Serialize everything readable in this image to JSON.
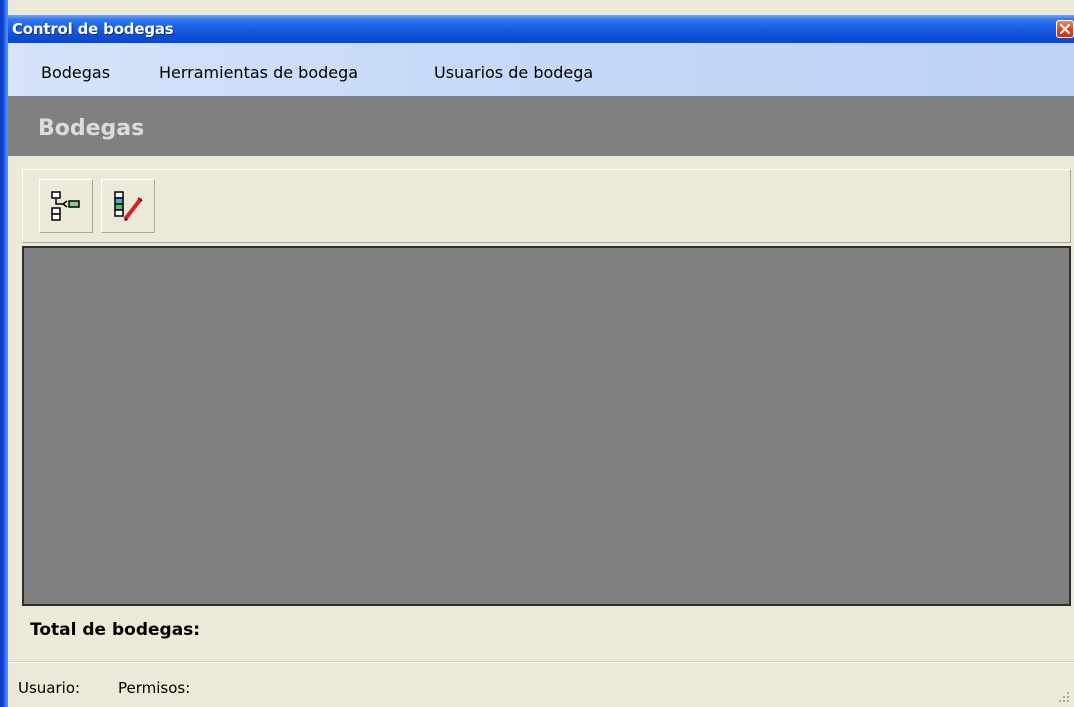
{
  "window": {
    "title": "Control de bodegas",
    "colors": {
      "titlebar": "#0f4fd8",
      "close": "#d8421c",
      "menubar": "#c7d9f8",
      "header": "#808080",
      "content": "#808080",
      "chrome": "#ece9d8"
    }
  },
  "menubar": {
    "items": [
      {
        "label": "Bodegas"
      },
      {
        "label": "Herramientas de bodega"
      },
      {
        "label": "Usuarios de bodega"
      }
    ]
  },
  "header": {
    "title": "Bodegas"
  },
  "toolbar": {
    "buttons": [
      {
        "icon": "tree-add-icon"
      },
      {
        "icon": "list-edit-icon"
      }
    ]
  },
  "summary": {
    "total_label": "Total de bodegas:"
  },
  "statusbar": {
    "user_label": "Usuario:",
    "permissions_label": "Permisos:"
  }
}
